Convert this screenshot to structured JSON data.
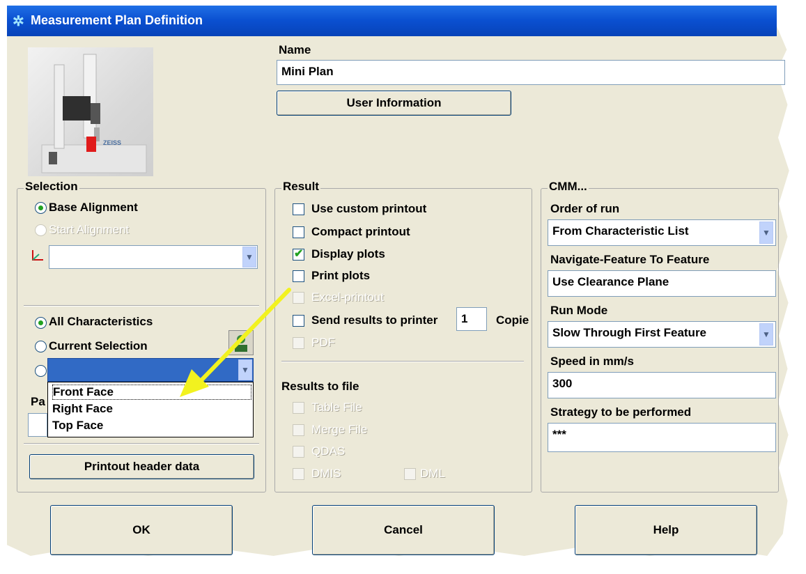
{
  "window": {
    "title": "Measurement Plan Definition"
  },
  "name_section": {
    "label": "Name",
    "value": "Mini Plan",
    "user_info_button": "User Information"
  },
  "selection": {
    "group_label": "Selection",
    "base_alignment": "Base Alignment",
    "start_alignment": "Start Alignment",
    "all_characteristics": "All Characteristics",
    "current_selection": "Current Selection",
    "dropdown_options": [
      "Front Face",
      "Right Face",
      "Top Face"
    ],
    "partial_label": "Pa",
    "printout_header_button": "Printout header data"
  },
  "result": {
    "group_label": "Result",
    "use_custom_printout": "Use custom printout",
    "compact_printout": "Compact printout",
    "display_plots": "Display plots",
    "print_plots": "Print plots",
    "excel_printout": "Excel-printout",
    "send_results": "Send results to printer",
    "copies_value": "1",
    "copies_label": "Copie",
    "pdf": "PDF"
  },
  "results_to_file": {
    "label": "Results to file",
    "table_file": "Table File",
    "merge_file": "Merge File",
    "qdas": "QDAS",
    "dmis": "DMIS",
    "dml": "DML"
  },
  "cmm": {
    "group_label": "CMM...",
    "order_of_run_label": "Order of run",
    "order_of_run_value": "From Characteristic List",
    "navigate_label": "Navigate-Feature To Feature",
    "navigate_value": "Use Clearance Plane",
    "run_mode_label": "Run Mode",
    "run_mode_value": "Slow Through First Feature",
    "speed_label": "Speed in mm/s",
    "speed_value": "300",
    "strategy_label": "Strategy to be performed",
    "strategy_value": "***"
  },
  "buttons": {
    "ok": "OK",
    "cancel": "Cancel",
    "help": "Help"
  },
  "colors": {
    "titlebar": "#0a4fd0",
    "dialog_bg": "#ece9d8",
    "selected_dropdown": "#316ac5",
    "arrow": "#f2f21f"
  }
}
